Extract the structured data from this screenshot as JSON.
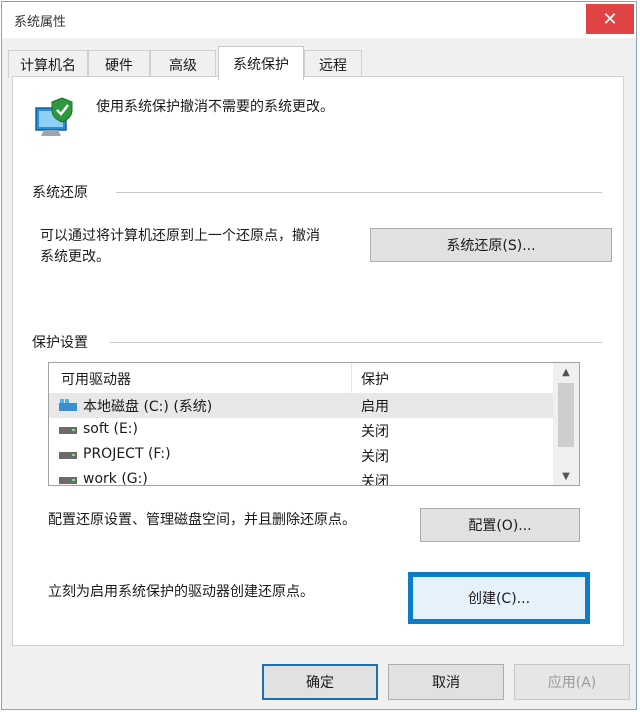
{
  "window": {
    "title": "系统属性",
    "close_glyph": "✕"
  },
  "tabs": [
    {
      "label": "计算机名",
      "active": false
    },
    {
      "label": "硬件",
      "active": false
    },
    {
      "label": "高级",
      "active": false
    },
    {
      "label": "系统保护",
      "active": true
    },
    {
      "label": "远程",
      "active": false
    }
  ],
  "header": {
    "icon": "system-protection-shield-icon",
    "description": "使用系统保护撤消不需要的系统更改。"
  },
  "restore": {
    "group_label": "系统还原",
    "text_line1": "可以通过将计算机还原到上一个还原点，撤消",
    "text_line2": "系统更改。",
    "button": "系统还原(S)..."
  },
  "protection": {
    "group_label": "保护设置",
    "columns": [
      "可用驱动器",
      "保护"
    ],
    "drives": [
      {
        "name": "本地磁盘 (C:) (系统)",
        "status": "启用",
        "icon": "system-drive-icon",
        "selected": true
      },
      {
        "name": "soft (E:)",
        "status": "关闭",
        "icon": "drive-icon",
        "selected": false
      },
      {
        "name": "PROJECT (F:)",
        "status": "关闭",
        "icon": "drive-icon",
        "selected": false
      },
      {
        "name": "work (G:)",
        "status": "关闭",
        "icon": "drive-icon",
        "selected": false
      }
    ],
    "configure_text": "配置还原设置、管理磁盘空间，并且删除还原点。",
    "configure_button": "配置(O)...",
    "create_text": "立刻为启用系统保护的驱动器创建还原点。",
    "create_button": "创建(C)..."
  },
  "footer": {
    "ok": "确定",
    "cancel": "取消",
    "apply": "应用(A)"
  },
  "colors": {
    "focus_border": "#0f7cc8",
    "close_bg": "#e04343"
  }
}
